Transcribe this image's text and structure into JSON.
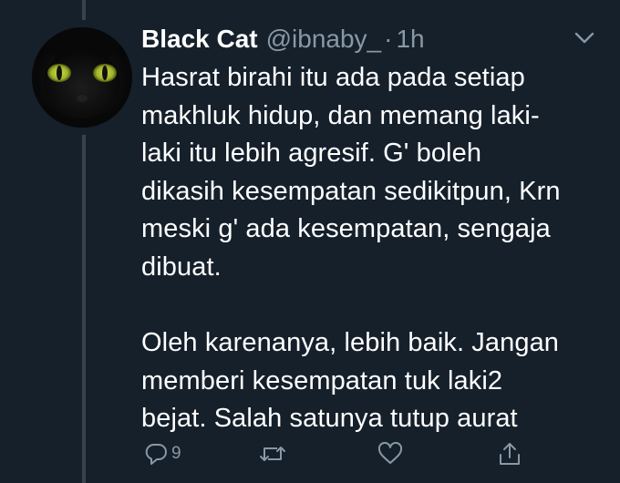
{
  "tweet": {
    "display_name": "Black Cat",
    "handle": "@ibnaby_",
    "separator": "·",
    "time": "1h",
    "paragraphs": [
      "Hasrat birahi itu ada pada setiap\nmakhluk hidup, dan memang laki-\nlaki itu lebih agresif. G' boleh\ndikasih kesempatan sedikitpun, Krn\nmeski g' ada kesempatan, sengaja\ndibuat.",
      "Oleh karenanya, lebih baik. Jangan\nmemberi kesempatan tuk laki2\nbejat. Salah satunya tutup aurat"
    ]
  },
  "actions": {
    "reply_count": "9"
  },
  "icons": {
    "menu": "chevron-down-icon",
    "reply": "reply-icon",
    "retweet": "retweet-icon",
    "like": "heart-icon",
    "share": "share-icon"
  },
  "colors": {
    "background": "#15202b",
    "secondary_text": "#8899a6",
    "thread_line": "#38444d",
    "cat_eyes": "#b8c83a"
  }
}
